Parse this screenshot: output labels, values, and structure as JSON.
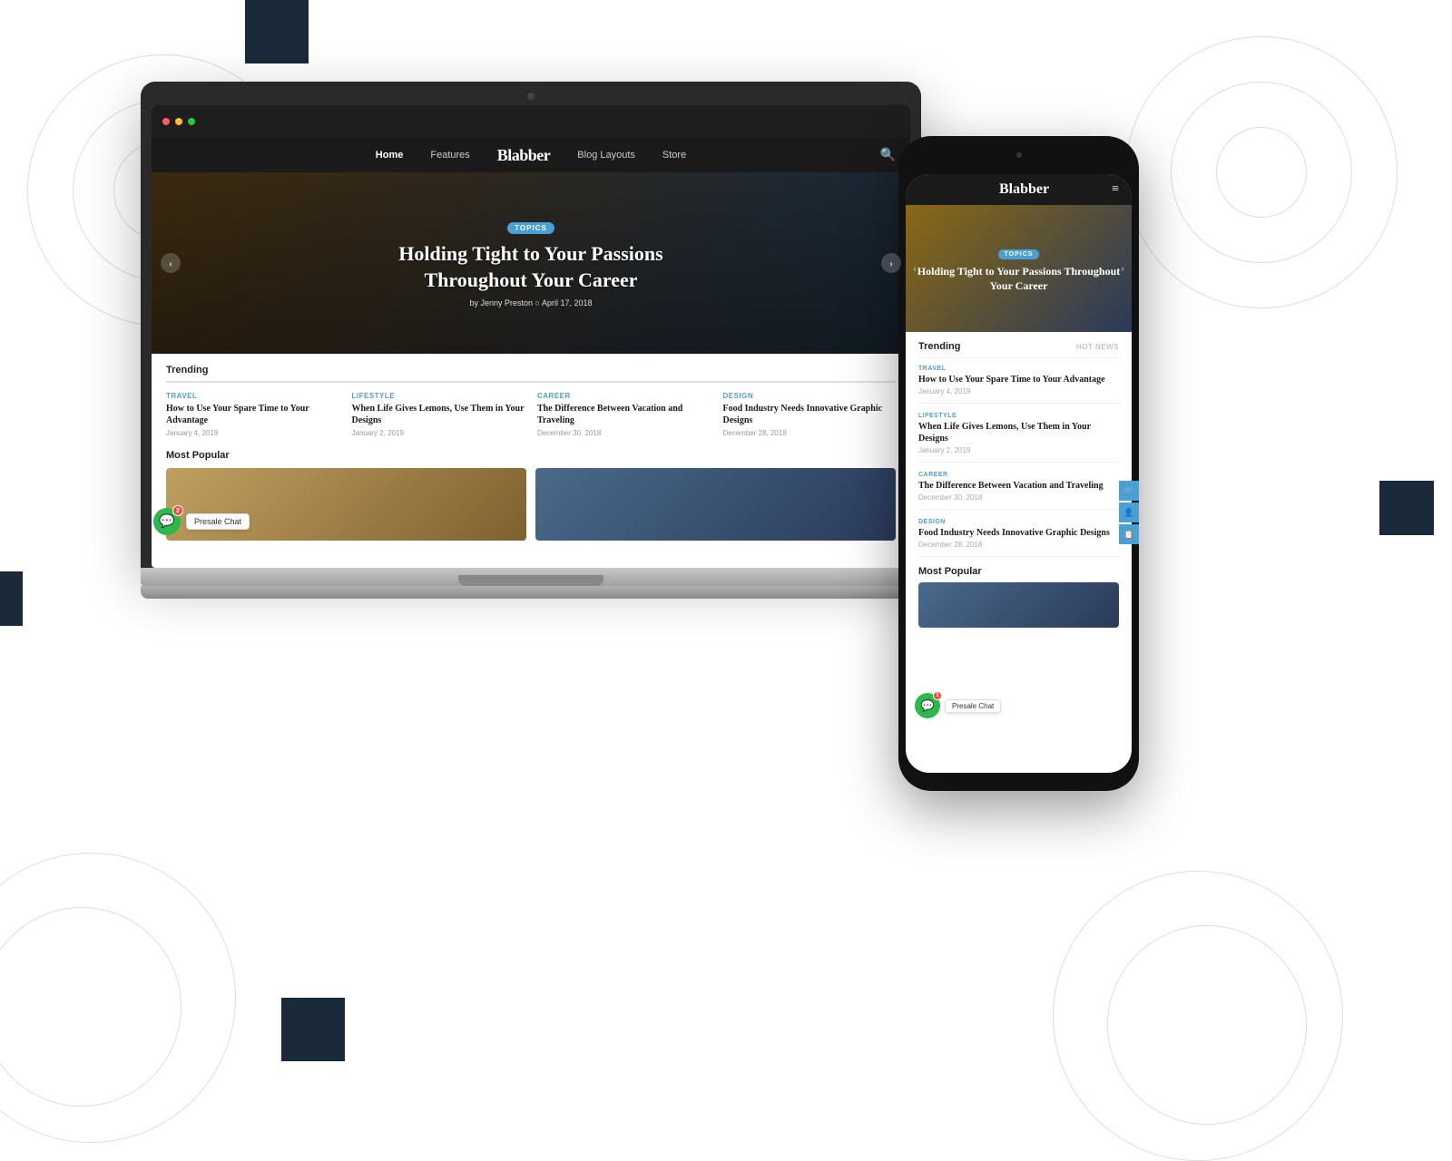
{
  "page": {
    "bg_squares": [
      "top",
      "right",
      "left",
      "bottom"
    ]
  },
  "laptop": {
    "nav": {
      "items": [
        {
          "label": "Home",
          "active": true
        },
        {
          "label": "Features",
          "active": false
        },
        {
          "label": "Blog Layouts",
          "active": false
        },
        {
          "label": "Store",
          "active": false
        }
      ],
      "logo": "Blabber",
      "search_label": "🔍"
    },
    "hero": {
      "tag": "TOPICS",
      "title": "Holding Tight to Your Passions\nThroughout Your Career",
      "meta": "by Jenny Preston  ○  April 17, 2018",
      "arrow_left": "‹",
      "arrow_right": "›"
    },
    "trending": {
      "label": "Trending",
      "articles": [
        {
          "category": "TRAVEL",
          "title": "How to Use Your Spare Time to Your Advantage",
          "date": "January 4, 2019"
        },
        {
          "category": "LIFESTYLE",
          "title": "When Life Gives Lemons, Use Them in Your Designs",
          "date": "January 2, 2019"
        },
        {
          "category": "CAREER",
          "title": "The Difference Between Vacation and Traveling",
          "date": "December 30, 2018"
        },
        {
          "category": "DESIGN",
          "title": "Food Industry Needs Innovative Graphic Designs",
          "date": "December 28, 2018"
        }
      ]
    },
    "most_popular": {
      "label": "Most Popular"
    },
    "chat": {
      "label": "Presale Chat",
      "badge": "2"
    }
  },
  "phone": {
    "nav": {
      "logo": "Blabber",
      "menu_icon": "≡"
    },
    "hero": {
      "tag": "TOPICS",
      "title": "Holding Tight to Your Passions Throughout Your Career",
      "arrow_left": "‹",
      "arrow_right": "›"
    },
    "trending": {
      "label": "Trending",
      "hot_news": "HOT NEWS",
      "articles": [
        {
          "category": "TRAVEL",
          "title": "How to Use Your Spare Time to Your Advantage",
          "date": "January 4, 2019"
        },
        {
          "category": "LIFESTYLE",
          "title": "When Life Gives Lemons, Use Them in Your Designs",
          "date": "January 2, 2019"
        },
        {
          "category": "CAREER",
          "title": "The Difference Between Vacation and Traveling",
          "date": "December 30, 2018"
        },
        {
          "category": "DESIGN",
          "title": "Food Industry Needs Innovative Graphic Designs",
          "date": "December 28, 2018"
        }
      ]
    },
    "most_popular": {
      "label": "Most Popular"
    },
    "chat": {
      "label": "Presale Chat",
      "badge": "1"
    }
  }
}
